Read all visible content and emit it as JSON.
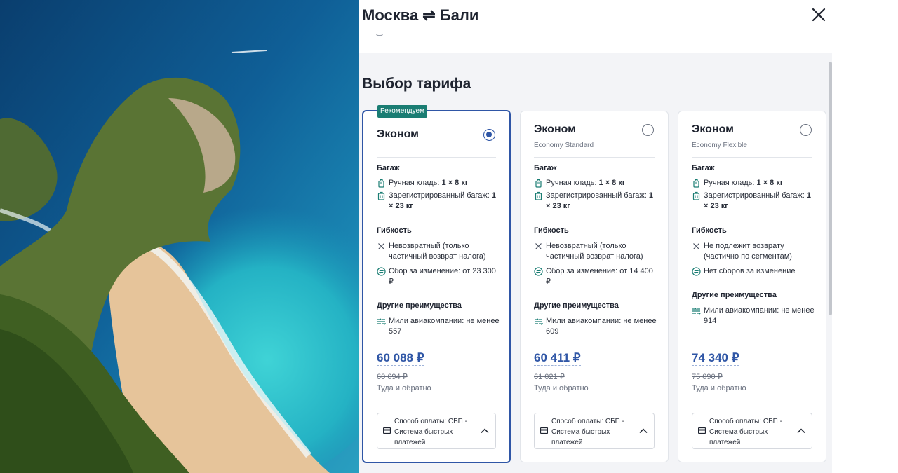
{
  "header": {
    "title": "Москва ⇌ Бали",
    "close_icon": "close-icon"
  },
  "section_title": "Выбор тарифа",
  "photo": {
    "alt_subject": "tropical-coastline-photo"
  },
  "colors": {
    "accent": "#2f56a6",
    "badge": "#1a7d73",
    "panel_bg": "#f3f4f7"
  },
  "fares": [
    {
      "badge": "Рекомендуем",
      "name": "Эконом",
      "subtitle": "",
      "selected": true,
      "baggage_title": "Багаж",
      "carry_on_label": "Ручная кладь: ",
      "carry_on_value": "1 × 8 кг",
      "checked_label": "Зарегистрированный багаж: ",
      "checked_value": "1 × 23 кг",
      "flex_title": "Гибкость",
      "refund": "Невозвратный (только частичный возврат налога)",
      "change": "Сбор за изменение: от 23 300 ₽",
      "other_title": "Другие преимущества",
      "miles": "Мили авиакомпании: не менее 557",
      "price": "60 088 ₽",
      "old_price": "60 694 ₽",
      "trip": "Туда и обратно",
      "payment": "Способ оплаты: СБП - Система быстрых платежей"
    },
    {
      "badge": "",
      "name": "Эконом",
      "subtitle": "Economy Standard",
      "selected": false,
      "baggage_title": "Багаж",
      "carry_on_label": "Ручная кладь: ",
      "carry_on_value": "1 × 8 кг",
      "checked_label": "Зарегистрированный багаж: ",
      "checked_value": "1 × 23 кг",
      "flex_title": "Гибкость",
      "refund": "Невозвратный (только частичный возврат налога)",
      "change": "Сбор за изменение: от 14 400 ₽",
      "other_title": "Другие преимущества",
      "miles": "Мили авиакомпании: не менее 609",
      "price": "60 411 ₽",
      "old_price": "61 021 ₽",
      "trip": "Туда и обратно",
      "payment": "Способ оплаты: СБП - Система быстрых платежей"
    },
    {
      "badge": "",
      "name": "Эконом",
      "subtitle": "Economy Flexible",
      "selected": false,
      "baggage_title": "Багаж",
      "carry_on_label": "Ручная кладь: ",
      "carry_on_value": "1 × 8 кг",
      "checked_label": "Зарегистрированный багаж: ",
      "checked_value": "1 × 23 кг",
      "flex_title": "Гибкость",
      "refund": "Не подлежит возврату (частично по сегментам)",
      "change": "Нет сборов за изменение",
      "other_title": "Другие преимущества",
      "miles": "Мили авиакомпании: не менее 914",
      "price": "74 340 ₽",
      "old_price": "75 090 ₽",
      "trip": "Туда и обратно",
      "payment": "Способ оплаты: СБП - Система быстрых платежей"
    }
  ]
}
